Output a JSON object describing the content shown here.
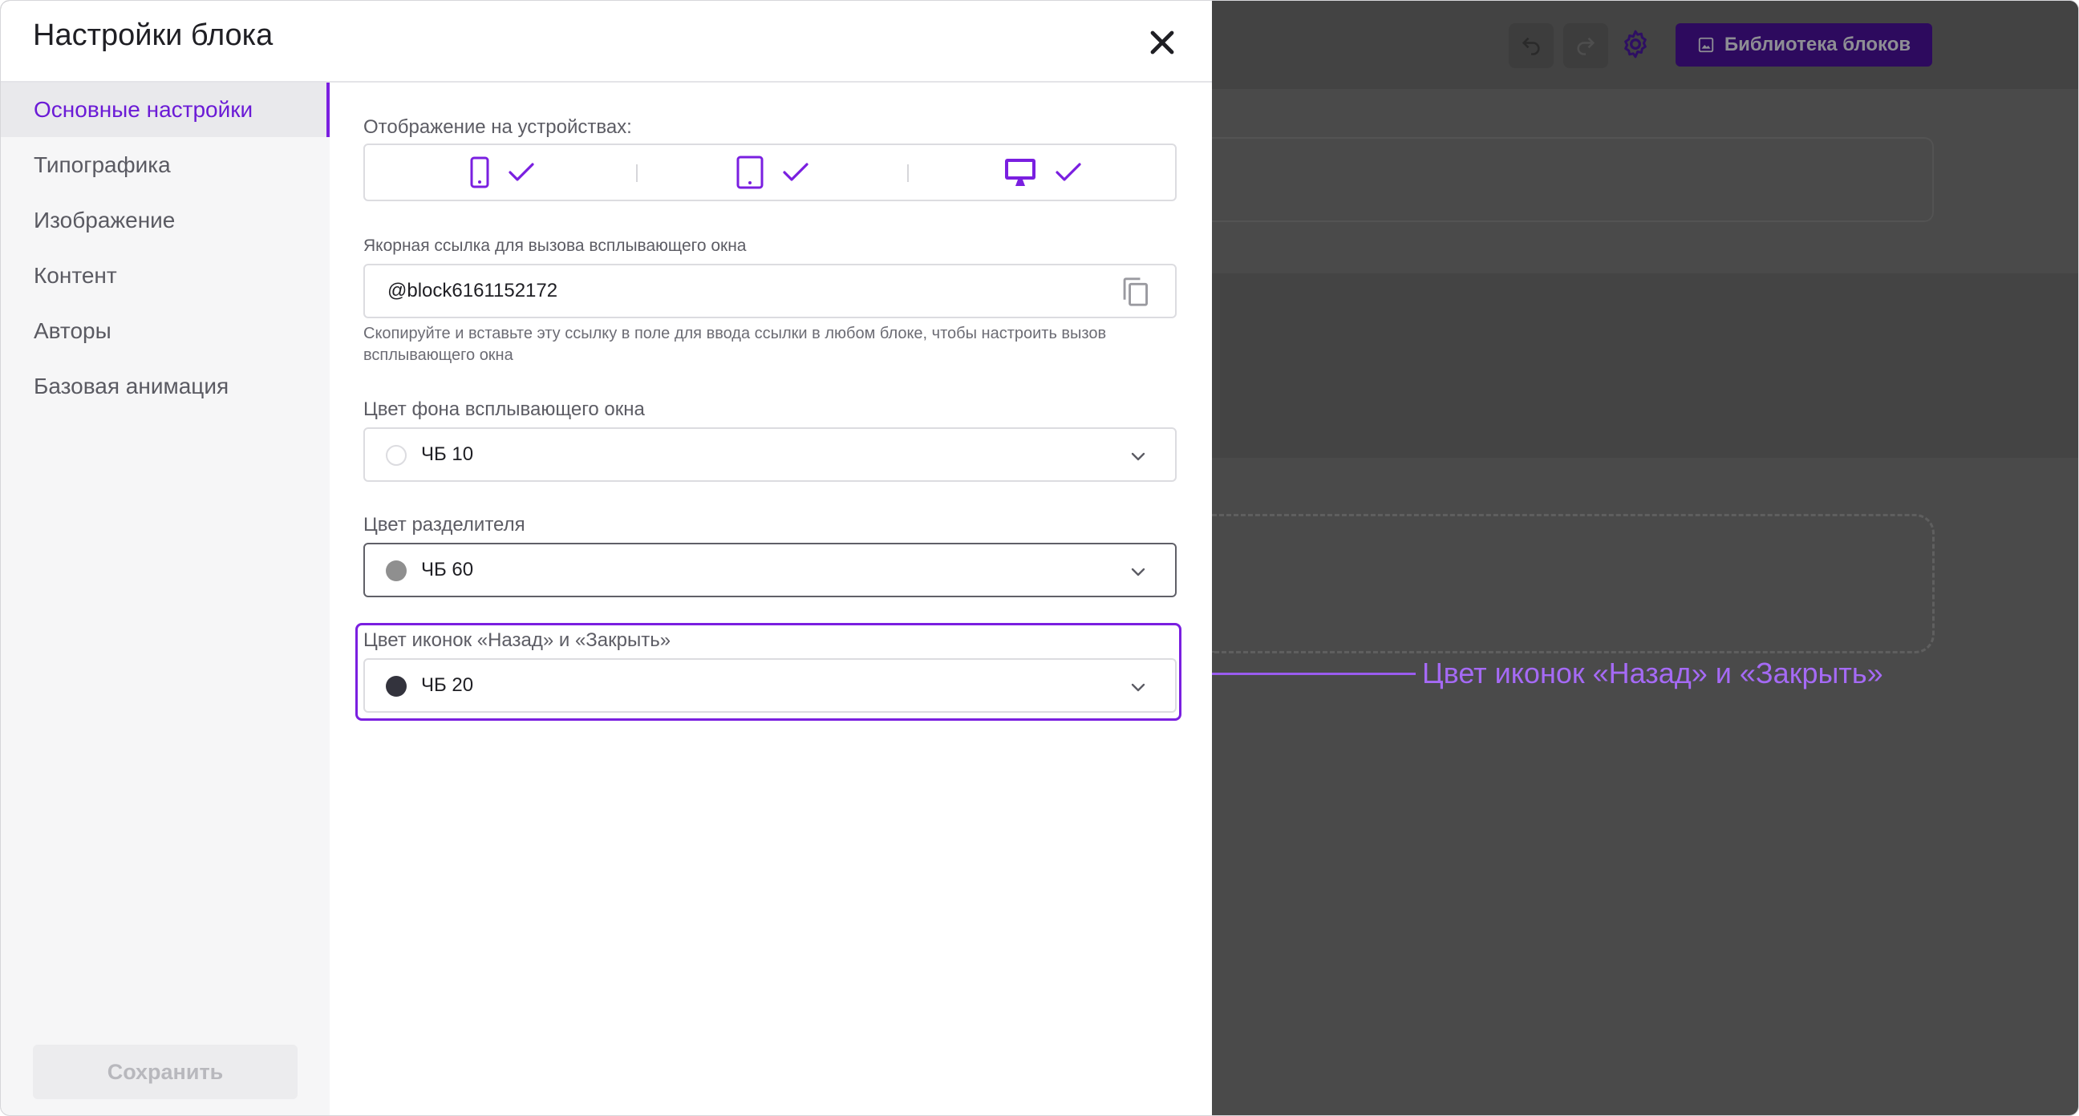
{
  "modal": {
    "title": "Настройки блока"
  },
  "sidebar": {
    "items": [
      {
        "label": "Основные настройки",
        "active": true
      },
      {
        "label": "Типографика",
        "active": false
      },
      {
        "label": "Изображение",
        "active": false
      },
      {
        "label": "Контент",
        "active": false
      },
      {
        "label": "Авторы",
        "active": false
      },
      {
        "label": "Базовая анимация",
        "active": false
      }
    ],
    "save_label": "Сохранить"
  },
  "settings": {
    "devices_label": "Отображение на устройствах:",
    "devices": [
      {
        "icon": "phone-icon",
        "checked": true
      },
      {
        "icon": "tablet-icon",
        "checked": true
      },
      {
        "icon": "desktop-icon",
        "checked": true
      }
    ],
    "anchor_label": "Якорная ссылка для вызова всплывающего окна",
    "anchor_value": "@block6161152172",
    "anchor_hint": "Скопируйте и вставьте эту ссылку в поле для ввода ссылки в любом блоке, чтобы настроить вызов всплывающего окна",
    "bg_color_label": "Цвет фона всплывающего окна",
    "bg_color_value": "ЧБ 10",
    "bg_color_swatch": "#ffffff",
    "divider_color_label": "Цвет разделителя",
    "divider_color_value": "ЧБ 60",
    "divider_color_swatch": "#8f8f8f",
    "icons_color_label": "Цвет иконок «Назад» и «Закрыть»",
    "icons_color_value": "ЧБ 20",
    "icons_color_swatch": "#33333d"
  },
  "editor": {
    "library_button": "Библиотека блоков"
  },
  "annotation": {
    "text": "Цвет иконок «Назад» и «Закрыть»"
  },
  "colors": {
    "accent": "#7a1fe0",
    "annotation": "#a56af5",
    "overlay": "#4a4a4a"
  }
}
